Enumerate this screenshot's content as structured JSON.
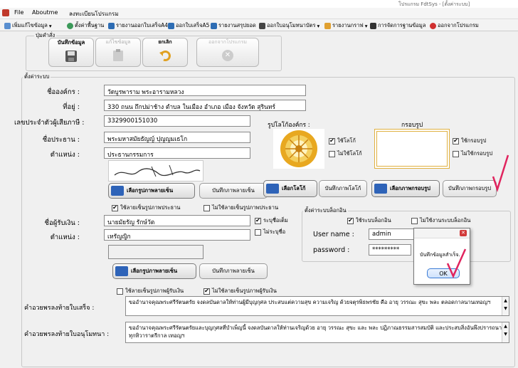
{
  "window": {
    "title": "โปรแกรม FdtSys - [ตั้งค่าระบบ]"
  },
  "menu": [
    "File",
    "Aboutme",
    "ลงทะเบียนโปรแกรม"
  ],
  "toolbar": [
    "เพิ่มแก้ไขข้อมูล",
    "ตั้งค่าพื้นฐาน",
    "รายงานออกใบเสร็จA4",
    "ออกใบเสร็จA5",
    "รายงานสรุปยอด",
    "ออกใบอนุโมทนาบัตร",
    "รายงานกราฟ",
    "การจัดการฐานข้อมูล",
    "ออกจากโปรแกรม"
  ],
  "manage": {
    "title": "ปุ่มคำสั่ง",
    "save": "บันทึกข้อมูล",
    "edit": "แก้ไขข้อมูล",
    "cancel": "ยกเลิก",
    "exit": "ออกจากโปรแกรม"
  },
  "settings": {
    "title": "ตั้งค่าระบบ"
  },
  "org": {
    "name_label": "ชื่อองค์กร :",
    "name": "วัดบูรพาราม พระอารามหลวง",
    "addr_label": "ที่อยู่ :",
    "addr": "330 ถนน ถึกปม่าช้าง ตำบล ในเมือง อำเภอ เมือง จังหวัด สุรินทร์",
    "tax_label": "เลขประจำตัวผู้เสียภาษี :",
    "tax": "3329900151030",
    "chair_label": "ชื่อประธาน :",
    "chair": "พระมหาสมัยธัญญ์ ปุญญมเธโก",
    "pos_label": "ตำแหน่ง :",
    "pos": "ประธานกรรมการ"
  },
  "sig1": {
    "text": "รูปลายเซ็นประธาน",
    "choose": "เลือกรูปภาพลายเซ็น",
    "save": "บันทึกภาพลายเซ็น",
    "use": "ใช้ลายเซ็นรูปภาพประธาน",
    "nouse": "ไม่ใช้ลายเซ็นรูปภาพประธาน"
  },
  "logo": {
    "title": "รูปโลโก้องค์กร :",
    "use": "ใช้โลโก้",
    "nouse": "ไม่ใช้โลโก้",
    "choose": "เลือกโลโก้",
    "save": "บันทึกภาพโลโก้"
  },
  "frame": {
    "title": "กรอบรูป",
    "use": "ใช้กรอบรูป",
    "nouse": "ไม่ใช้กรอบรูป",
    "choose": "เลือกภาพกรอบรูป",
    "save": "บันทึกภาพกรอบรูป"
  },
  "login": {
    "title": "ตั้งค่าระบบล็อกอิน",
    "use": "ใช้ระบบล็อกอิน",
    "nouse": "ไม่ใช้งานระบบล็อกอิน",
    "user_label": "User name :",
    "user": "admin",
    "pass_label": "password :",
    "pass": "*********"
  },
  "receiver": {
    "name_label": "ชื่อผู้รับเงิน :",
    "name": "นายมัยรัญ รักษ์วัต",
    "pos_label": "ตำแหน่ง :",
    "pos": "เหรัญญิก",
    "showname": "ระบุชื่อเต็ม",
    "noname": "ไม่ระบุชื่อ"
  },
  "sig2": {
    "choose": "เลือกรูปภาพลายเซ็น",
    "save": "บันทึกภาพลายเซ็น",
    "use": "ใช้ลายเซ็นรูปภาพผู้รับเงิน",
    "nouse": "ไม่ใช้ลายเซ็นรูปภาพผู้รับเงิน"
  },
  "blessing": {
    "receipt_label": "คำอวยพรลงท้ายใบเสร็จ :",
    "receipt": "ขออำนาจคุณพระศรีรัตนตรัย จงดลบันดาลให้ท่านผู้มีบุญกุศล ประสบแต่ความสุข ความเจริญ ด้วยจตุรพิธพรชัย คือ อายุ วรรณะ สุขะ พละ ตลอดกาลนานเทอญฯ",
    "cert_label": "คำอวยพรลงท้ายใบอนุโมทนา :",
    "cert": "ขออำนาจคุณพระศรีรัตนตรัยและบุญกุศลที่บำเพ็ญนี้ จงดลบันดาลให้ท่านเจริญด้วย อายุ วรรณะ สุขะ และ พละ ปฏิภาณธรรมสารสมบัติ และประสบสิ่งอันพึงปรารถนา ทุกทิวาราตรีกาล เทอญฯ"
  },
  "dialog": {
    "message": "บันทึกข้อมูลสำเร็จ.",
    "ok": "OK"
  }
}
